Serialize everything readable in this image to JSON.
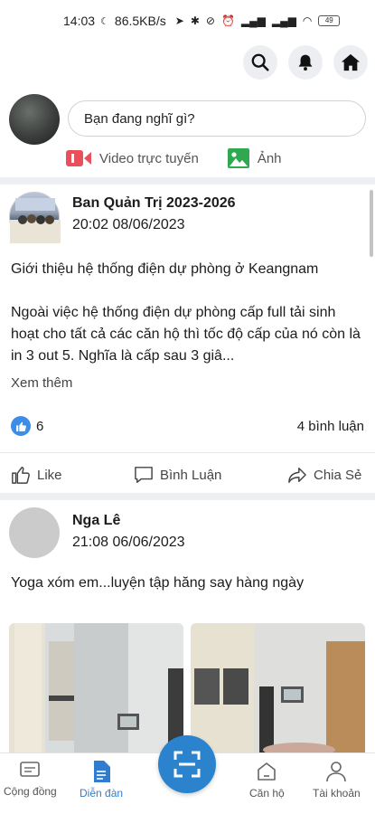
{
  "status_bar": {
    "time": "14:03",
    "net_speed": "86.5KB/s",
    "battery": "49"
  },
  "composer": {
    "placeholder": "Bạn đang nghĩ gì?",
    "live_label": "Video trực tuyến",
    "photo_label": "Ảnh"
  },
  "posts": [
    {
      "author": "Ban Quản Trị 2023-2026",
      "time": "20:02 08/06/2023",
      "title": "Giới thiệu hệ thống điện dự phòng ở Keangnam",
      "body": "Ngoài việc hệ thống điện dự phòng cấp full tải sinh hoạt cho tất cả các căn hộ thì tốc độ cấp của nó còn là in 3 out 5. Nghĩa là cấp sau 3 giâ...",
      "see_more": "Xem thêm",
      "likes": "6",
      "comments": "4 bình luận",
      "actions": {
        "like": "Like",
        "comment": "Bình Luận",
        "share": "Chia Sẻ"
      }
    },
    {
      "author": "Nga Lê",
      "time": "21:08 06/06/2023",
      "body": "Yoga xóm em...luyện tập hăng say hàng ngày"
    }
  ],
  "bottom_nav": {
    "community": "Cộng đồng",
    "forum": "Diễn đàn",
    "apartment": "Căn hộ",
    "account": "Tài khoản"
  },
  "colors": {
    "accent": "#2f7dd0",
    "like_blue": "#3d8de8",
    "live_red": "#e8505b",
    "photo_green": "#2fa84f"
  }
}
